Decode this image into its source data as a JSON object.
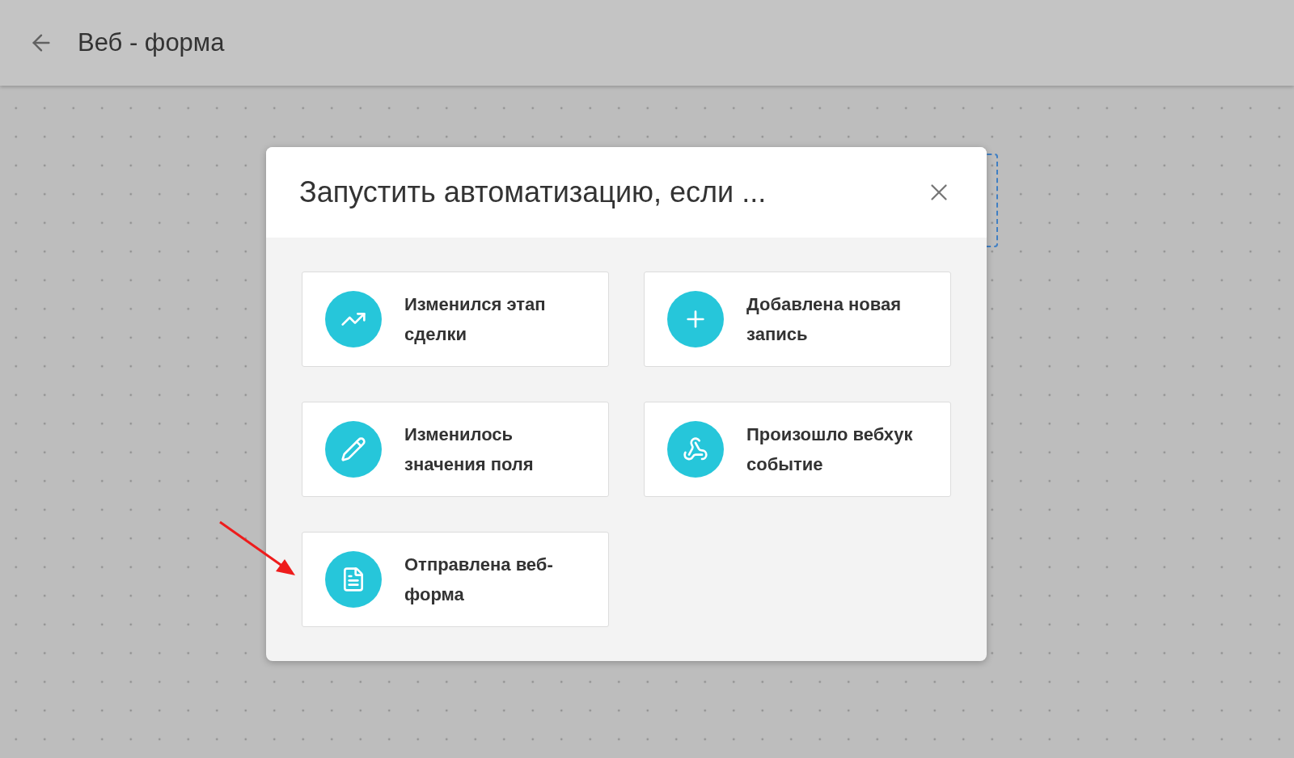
{
  "header": {
    "title": "Веб - форма"
  },
  "dialog": {
    "title": "Запустить автоматизацию, если ...",
    "options": [
      {
        "kind": "stage",
        "label": "Изменился этап сделки"
      },
      {
        "kind": "record",
        "label": "Добавлена новая запись"
      },
      {
        "kind": "field",
        "label": "Изменилось значения поля"
      },
      {
        "kind": "webhook",
        "label": "Произошло вебхук событие"
      },
      {
        "kind": "webform",
        "label": "Отправлена веб-форма"
      }
    ]
  }
}
